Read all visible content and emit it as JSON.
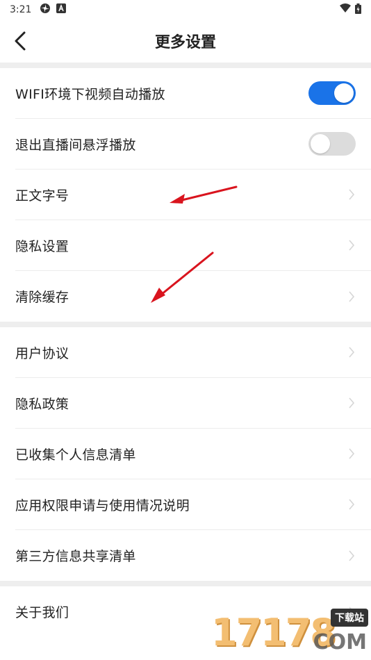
{
  "status_bar": {
    "time": "3:21"
  },
  "header": {
    "title": "更多设置"
  },
  "groups": [
    {
      "rows": [
        {
          "label": "WIFI环境下视频自动播放",
          "control": "toggle",
          "on": true
        },
        {
          "label": "退出直播间悬浮播放",
          "control": "toggle",
          "on": false
        },
        {
          "label": "正文字号",
          "control": "chevron"
        },
        {
          "label": "隐私设置",
          "control": "chevron"
        },
        {
          "label": "清除缓存",
          "control": "chevron"
        }
      ]
    },
    {
      "rows": [
        {
          "label": "用户协议",
          "control": "chevron"
        },
        {
          "label": "隐私政策",
          "control": "chevron"
        },
        {
          "label": "已收集个人信息清单",
          "control": "chevron"
        },
        {
          "label": "应用权限申请与使用情况说明",
          "control": "chevron"
        },
        {
          "label": "第三方信息共享清单",
          "control": "chevron"
        }
      ]
    },
    {
      "rows": [
        {
          "label": "关于我们",
          "control": "chevron"
        }
      ]
    }
  ],
  "watermark": {
    "number": "17178",
    "domain": "COM",
    "badge": "下载站"
  },
  "colors": {
    "toggle_on": "#1a73e8",
    "toggle_off": "#dcdcdc",
    "annotation_arrow": "#d9141e"
  }
}
